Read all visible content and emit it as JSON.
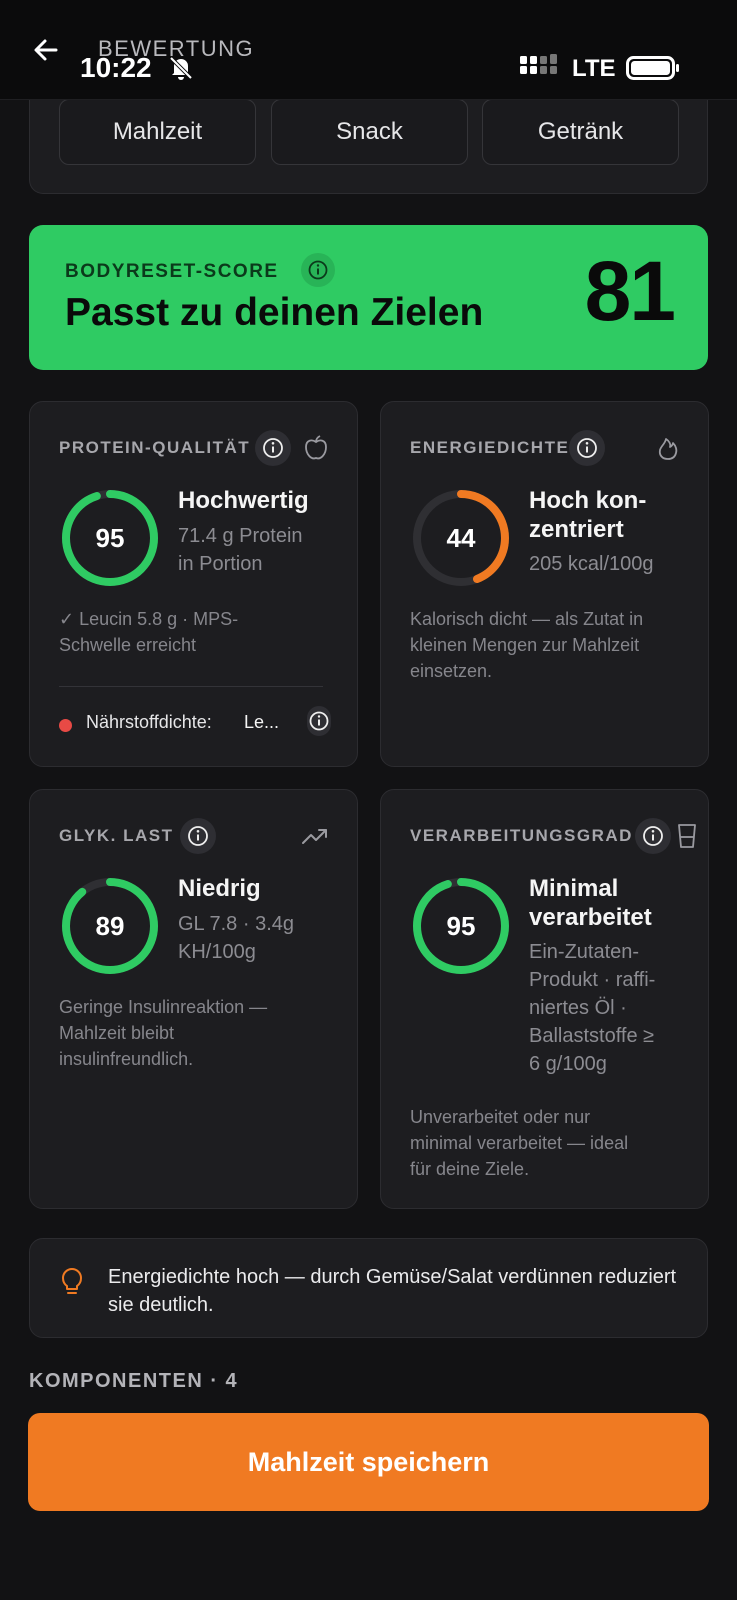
{
  "header": {
    "title": "BEWERTUNG"
  },
  "status_bar": {
    "time": "10:22",
    "network": "LTE"
  },
  "meal_types": [
    "Mahlzeit",
    "Snack",
    "Getränk"
  ],
  "score": {
    "label": "BODYRESET-SCORE",
    "title": "Passt zu deinen Zielen",
    "value": "81"
  },
  "protein": {
    "label": "PROTEIN-QUALITÄT",
    "value": "95",
    "level": 0.95,
    "ring_color": "#2fcb63",
    "title": "Hochwertig",
    "subtitle_lines": [
      "71.4 g Protein",
      "in Portion"
    ],
    "desc_lines": [
      "✓ Leucin 5.8 g · MPS-",
      "Schwelle erreicht"
    ],
    "nutrient_label": "Nährstoffdichte:",
    "nutrient_value": "Le...",
    "icon": "apple-icon"
  },
  "energy": {
    "label": "ENERGIEDICHTE",
    "value": "44",
    "level": 0.44,
    "ring_color": "#f07a22",
    "title_lines": [
      "Hoch kon-",
      "zentriert"
    ],
    "subtitle": "205 kcal/100g",
    "desc_lines": [
      "Kalorisch dicht — als Zutat in",
      "kleinen Mengen zur Mahlzeit",
      "einsetzen."
    ],
    "icon": "flame-icon"
  },
  "glyk": {
    "label": "GLYK. LAST",
    "value": "89",
    "level": 0.89,
    "ring_color": "#2fcb63",
    "title": "Niedrig",
    "subtitle_lines": [
      "GL 7.8 · 3.4g",
      "KH/100g"
    ],
    "desc_lines": [
      "Geringe Insulinreaktion —",
      "Mahlzeit bleibt",
      "insulinfreundlich."
    ],
    "icon": "trending-up-icon"
  },
  "processing": {
    "label": "VERARBEITUNGSGRAD",
    "value": "95",
    "level": 0.95,
    "ring_color": "#2fcb63",
    "title_lines": [
      "Minimal",
      "verarbeitet"
    ],
    "subtitle_lines": [
      "Ein-Zutaten-",
      "Produkt · raffi-",
      "niertes Öl ·",
      "Ballaststoffe ≥",
      "6 g/100g"
    ],
    "desc_lines": [
      "Unverarbeitet oder nur",
      "minimal verarbeitet — ideal",
      "für deine Ziele."
    ],
    "icon": "glass-icon"
  },
  "tip": {
    "text": "Energiedichte hoch — durch Gemüse/Salat verdünnen reduziert sie deutlich.",
    "icon": "lightbulb-icon"
  },
  "components": {
    "label": "KOMPONENTEN · 4"
  },
  "save_button": {
    "label": "Mahlzeit speichern"
  },
  "colors": {
    "green": "#2fcb63",
    "orange": "#f07a22",
    "background": "#121214",
    "card": "#1d1d20"
  }
}
